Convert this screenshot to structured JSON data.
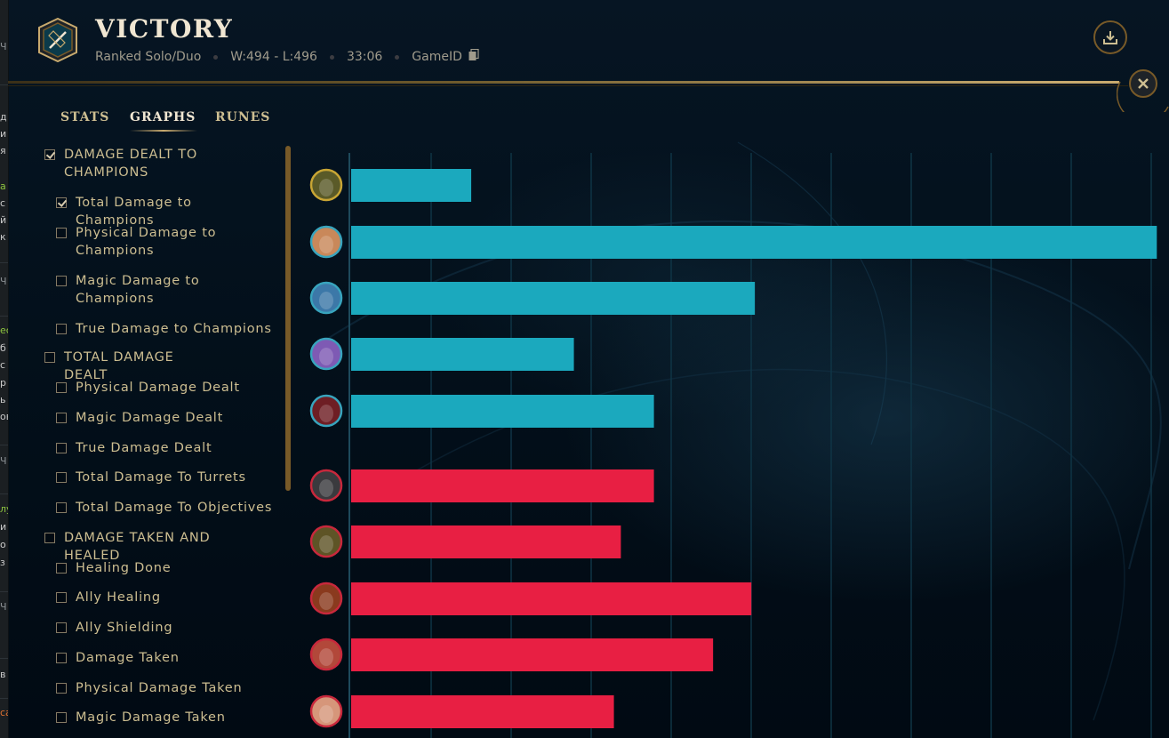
{
  "header": {
    "title": "VICTORY",
    "queue": "Ranked Solo/Duo",
    "record": "W:494 - L:496",
    "duration": "33:06",
    "game_id_label": "GameID",
    "icons": {
      "crest": "victory-crest-icon",
      "copy": "copy-icon",
      "download": "download-icon",
      "close": "close-icon"
    }
  },
  "tabs": [
    {
      "label": "STATS",
      "active": false
    },
    {
      "label": "GRAPHS",
      "active": true
    },
    {
      "label": "RUNES",
      "active": false
    }
  ],
  "checklist": [
    {
      "label": "DAMAGE DEALT TO CHAMPIONS",
      "checked": true,
      "category": true
    },
    {
      "label": "Total Damage to Champions",
      "checked": true,
      "category": false
    },
    {
      "label": "Physical Damage to Champions",
      "checked": false,
      "category": false
    },
    {
      "label": "Magic Damage to Champions",
      "checked": false,
      "category": false
    },
    {
      "label": "True Damage to Champions",
      "checked": false,
      "category": false
    },
    {
      "label": "TOTAL DAMAGE DEALT",
      "checked": false,
      "category": true
    },
    {
      "label": "Physical Damage Dealt",
      "checked": false,
      "category": false
    },
    {
      "label": "Magic Damage Dealt",
      "checked": false,
      "category": false
    },
    {
      "label": "True Damage Dealt",
      "checked": false,
      "category": false
    },
    {
      "label": "Total Damage To Turrets",
      "checked": false,
      "category": false
    },
    {
      "label": "Total Damage To Objectives",
      "checked": false,
      "category": false
    },
    {
      "label": "DAMAGE TAKEN AND HEALED",
      "checked": false,
      "category": true
    },
    {
      "label": "Healing Done",
      "checked": false,
      "category": false
    },
    {
      "label": "Ally Healing",
      "checked": false,
      "category": false
    },
    {
      "label": "Ally Shielding",
      "checked": false,
      "category": false
    },
    {
      "label": "Damage Taken",
      "checked": false,
      "category": false
    },
    {
      "label": "Physical Damage Taken",
      "checked": false,
      "category": false
    },
    {
      "label": "Magic Damage Taken",
      "checked": false,
      "category": false
    }
  ],
  "chart_data": {
    "type": "bar",
    "orientation": "horizontal",
    "grid": true,
    "xlim": [
      0,
      23.5
    ],
    "series": [
      {
        "team": "blue",
        "color": "#1ba9be",
        "values": [
          3.45,
          23.15,
          11.6,
          6.4,
          8.7
        ]
      },
      {
        "team": "red",
        "color": "#e81f43",
        "values": [
          8.7,
          7.75,
          11.5,
          10.4,
          7.55
        ]
      }
    ]
  },
  "players": [
    {
      "team": "blue",
      "icon": "champion-portrait-icon",
      "face": "#5a5a28",
      "ring": "#c8a534"
    },
    {
      "team": "blue",
      "icon": "champion-portrait-icon",
      "face": "#c9885a",
      "ring": "#38a4bd"
    },
    {
      "team": "blue",
      "icon": "champion-portrait-icon",
      "face": "#3c78a8",
      "ring": "#38a4bd"
    },
    {
      "team": "blue",
      "icon": "champion-portrait-icon",
      "face": "#7e5ab4",
      "ring": "#38a4bd"
    },
    {
      "team": "blue",
      "icon": "champion-portrait-icon",
      "face": "#6e1e24",
      "ring": "#38a4bd"
    },
    {
      "team": "red",
      "icon": "champion-portrait-icon",
      "face": "#3a3a3e",
      "ring": "#c8283c"
    },
    {
      "team": "red",
      "icon": "champion-portrait-icon",
      "face": "#5e5426",
      "ring": "#c8283c"
    },
    {
      "team": "red",
      "icon": "champion-portrait-icon",
      "face": "#8a3a1e",
      "ring": "#c8283c"
    },
    {
      "team": "red",
      "icon": "champion-portrait-icon",
      "face": "#b2483a",
      "ring": "#c8283c"
    },
    {
      "team": "red",
      "icon": "champion-portrait-icon",
      "face": "#d6967a",
      "ring": "#c8283c"
    }
  ],
  "background_app": {
    "fragments": [
      "Ч",
      "д",
      "и",
      "я",
      "а",
      "с",
      "й",
      "к",
      "Ч",
      "ес",
      "б",
      "с",
      "р",
      "ь",
      "ов",
      "Ч",
      "лу",
      "и",
      "о",
      "з",
      "Ч",
      "в",
      "са"
    ]
  }
}
